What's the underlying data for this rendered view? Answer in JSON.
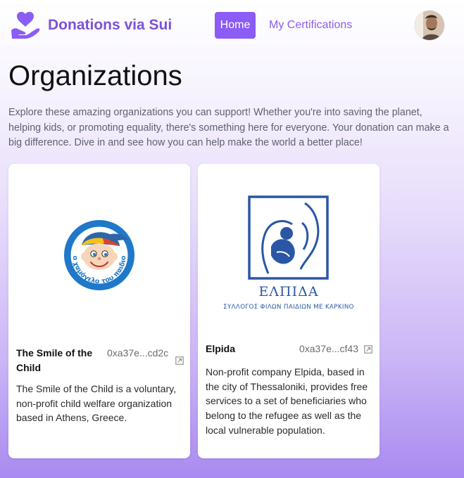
{
  "nav": {
    "brand_name": "Donations via Sui",
    "home_label": "Home",
    "certifications_label": "My Certifications"
  },
  "page": {
    "title": "Organizations",
    "intro": "Explore these amazing organizations you can support! Whether you're into saving the planet, helping kids, or promoting equality, there's something here for everyone. Your donation can make a big difference. Dive in and see how you can help make the world a better place!"
  },
  "organizations": [
    {
      "name": "The Smile of the Child",
      "address": "0xa37e...cd2c",
      "logo_text": "Το χαμόγελο του παιδιού",
      "description": "The Smile of the Child is a voluntary, non-profit child welfare organization based in Athens, Greece."
    },
    {
      "name": "Elpida",
      "address": "0xa37e...cf43",
      "logo_title": "ΕΛΠΙΔΑ",
      "logo_subtitle": "ΣΥΛΛΟΓΟΣ ΦΙΛΩΝ ΠΑΙΔΙΩΝ ΜΕ ΚΑΡΚΙΝΟ",
      "description": "Non-profit company Elpida, based in the city of Thessaloniki, provides free services to a set of beneficiaries who belong to the refugee as well as the local vulnerable population."
    }
  ],
  "colors": {
    "accent": "#8b5cf6",
    "brand_text": "#7b52d8",
    "smile_logo_blue": "#1f78c8",
    "elpida_logo_blue": "#2a56a6"
  }
}
